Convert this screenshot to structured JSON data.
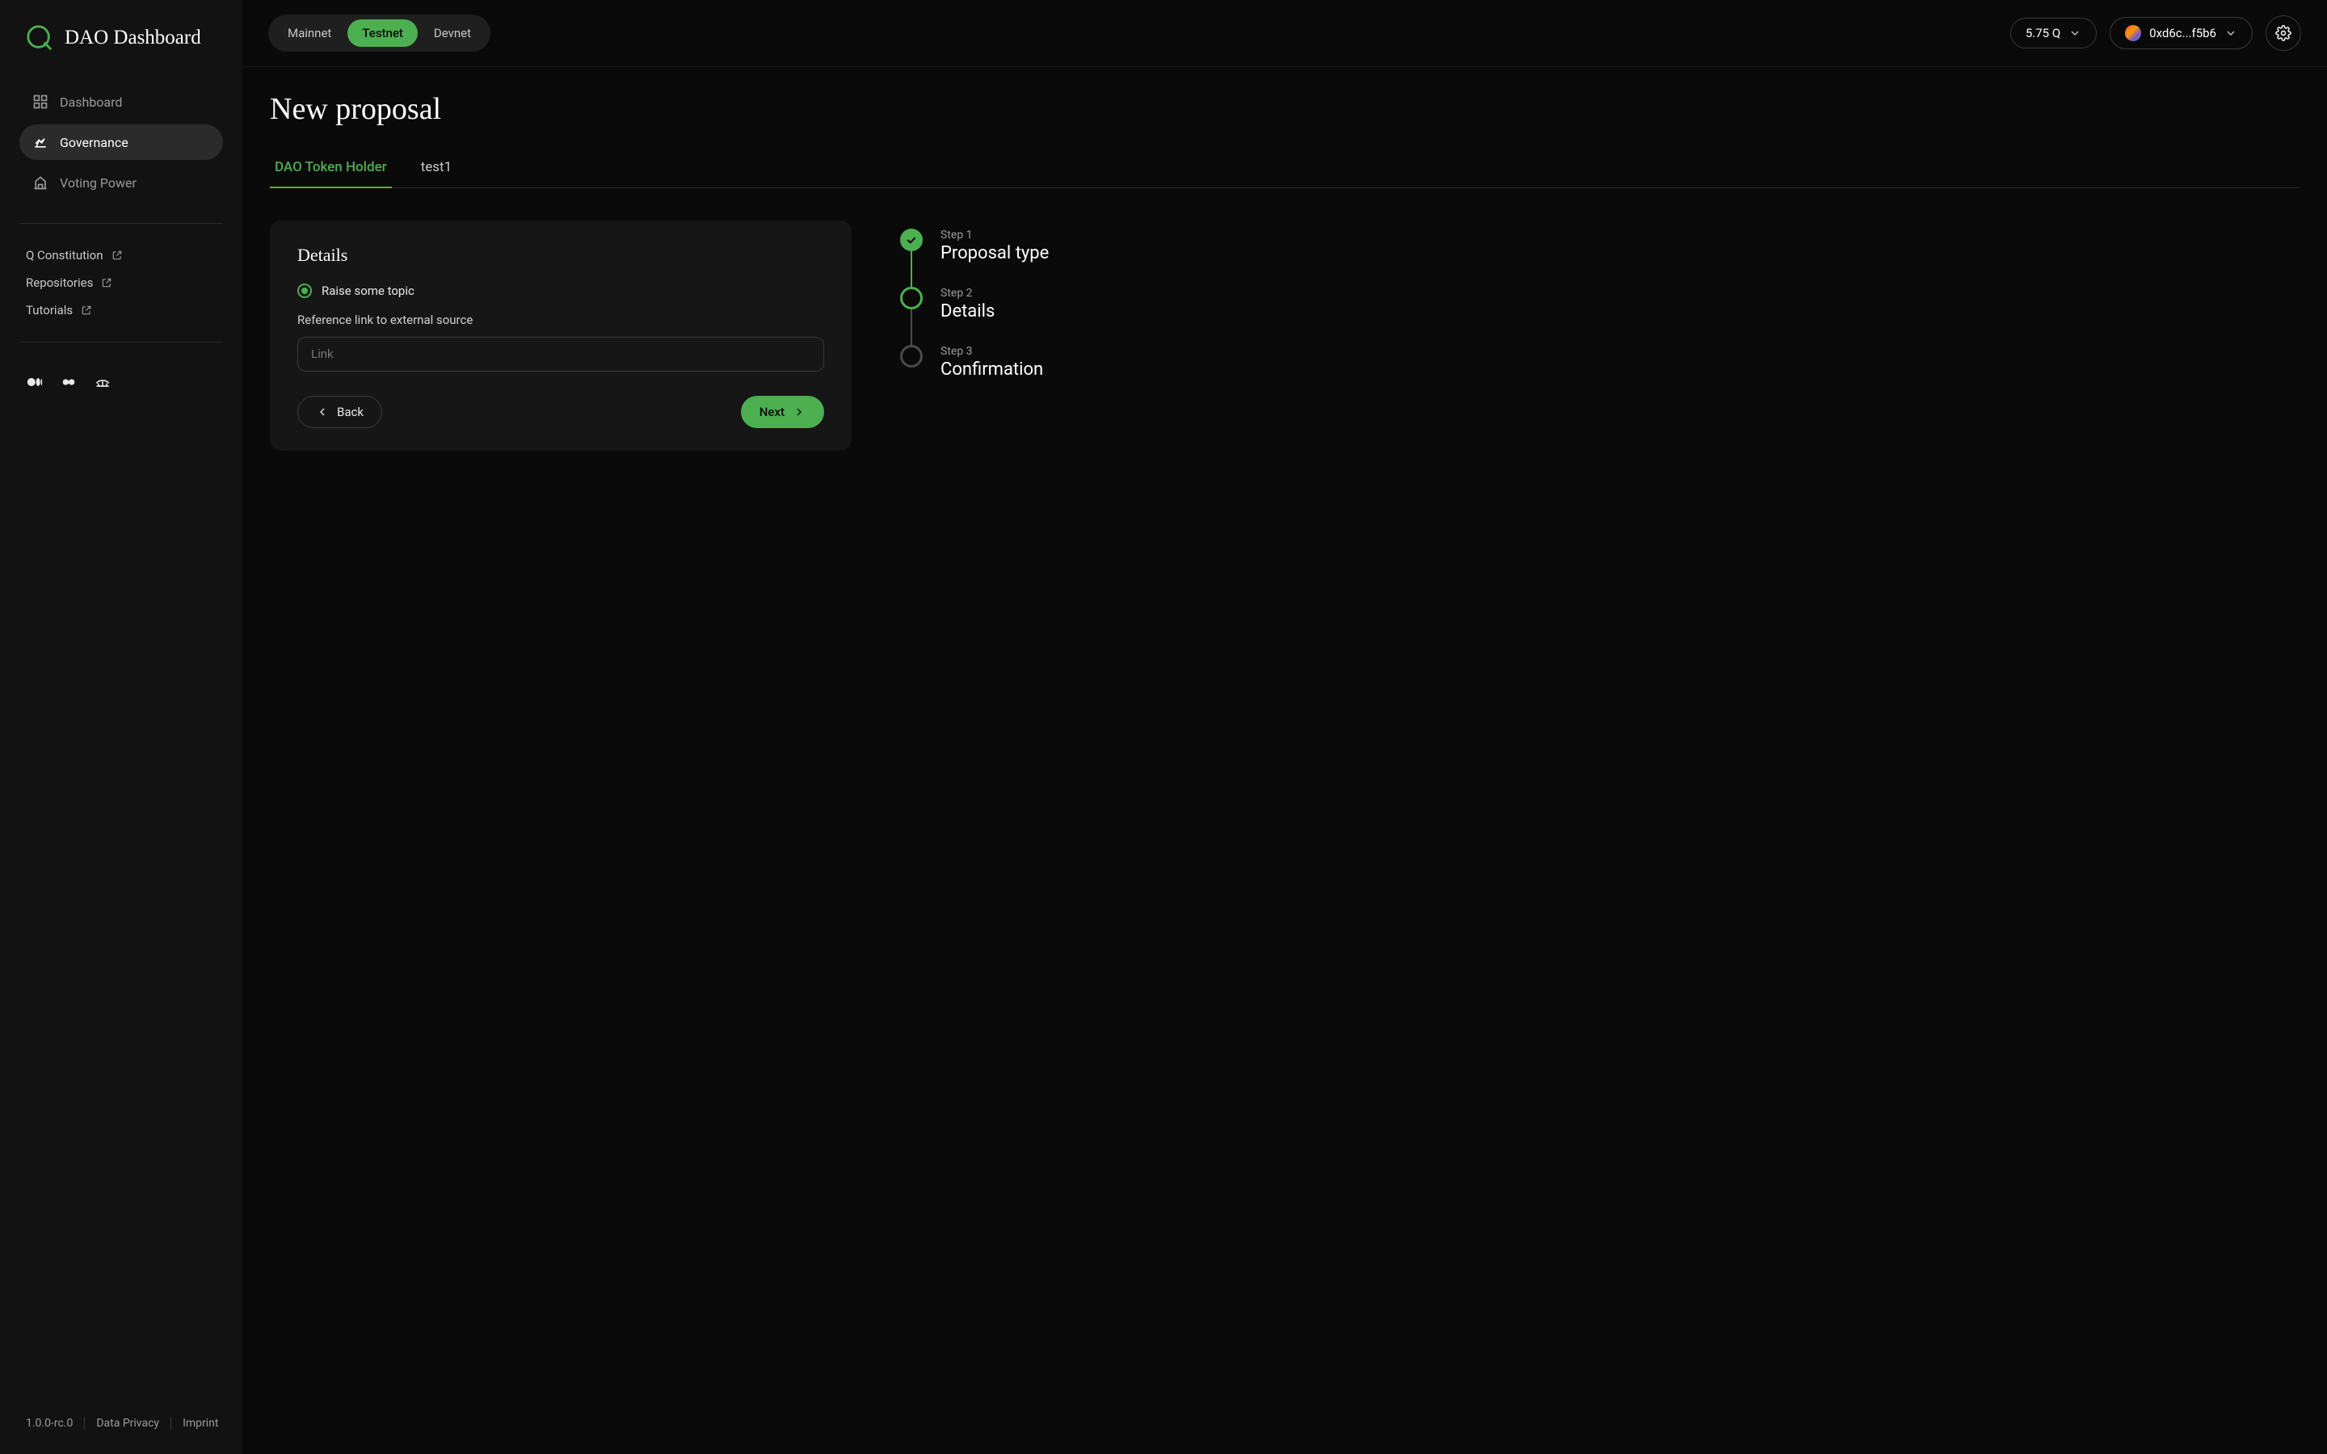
{
  "app": {
    "title": "DAO Dashboard"
  },
  "sidebar": {
    "nav": [
      {
        "label": "Dashboard"
      },
      {
        "label": "Governance"
      },
      {
        "label": "Voting Power"
      }
    ],
    "links": [
      {
        "label": "Q Constitution"
      },
      {
        "label": "Repositories"
      },
      {
        "label": "Tutorials"
      }
    ],
    "footer": {
      "version": "1.0.0-rc.0",
      "privacy": "Data Privacy",
      "imprint": "Imprint"
    }
  },
  "topbar": {
    "networks": [
      {
        "label": "Mainnet"
      },
      {
        "label": "Testnet"
      },
      {
        "label": "Devnet"
      }
    ],
    "balance": "5.75 Q",
    "wallet": "0xd6c...f5b6"
  },
  "page": {
    "title": "New proposal",
    "tabs": [
      {
        "label": "DAO Token Holder"
      },
      {
        "label": "test1"
      }
    ]
  },
  "card": {
    "title": "Details",
    "radio_label": "Raise some topic",
    "field_label": "Reference link to external source",
    "input_placeholder": "Link",
    "back_label": "Back",
    "next_label": "Next"
  },
  "stepper": [
    {
      "overline": "Step 1",
      "title": "Proposal type"
    },
    {
      "overline": "Step 2",
      "title": "Details"
    },
    {
      "overline": "Step 3",
      "title": "Confirmation"
    }
  ]
}
